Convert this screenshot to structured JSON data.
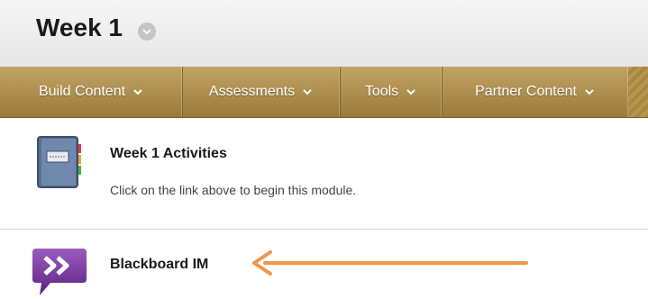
{
  "page": {
    "title": "Week 1"
  },
  "toolbar": {
    "items": [
      {
        "label": "Build Content"
      },
      {
        "label": "Assessments"
      },
      {
        "label": "Tools"
      },
      {
        "label": "Partner Content"
      }
    ]
  },
  "content": {
    "items": [
      {
        "title": "Week 1 Activities",
        "description": "Click on the link above to begin this module.",
        "icon": "module-notebook-icon"
      },
      {
        "title": "Blackboard IM",
        "icon": "blackboard-im-icon"
      }
    ]
  },
  "colors": {
    "toolbar_gold": "#b0904e",
    "annotation_arrow": "#f0954a",
    "im_purple": "#6a2e8e"
  }
}
